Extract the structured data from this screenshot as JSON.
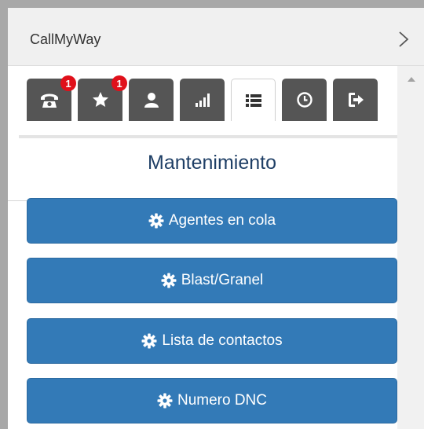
{
  "app": {
    "title": "CallMyWay"
  },
  "tabs": [
    {
      "icon": "phone-icon",
      "badge": "1",
      "active": false
    },
    {
      "icon": "star-icon",
      "badge": "1",
      "active": false
    },
    {
      "icon": "user-icon",
      "badge": "",
      "active": false
    },
    {
      "icon": "signal-bars-icon",
      "badge": "",
      "active": false
    },
    {
      "icon": "list-icon",
      "badge": "",
      "active": true
    },
    {
      "icon": "clock-icon",
      "badge": "",
      "active": false
    },
    {
      "icon": "logout-icon",
      "badge": "",
      "active": false
    }
  ],
  "section": {
    "title": "Mantenimiento"
  },
  "buttons": [
    {
      "label": "Agentes en cola",
      "icon": "gear-icon"
    },
    {
      "label": "Blast/Granel",
      "icon": "gear-icon"
    },
    {
      "label": "Lista de contactos",
      "icon": "gear-icon"
    },
    {
      "label": "Numero DNC",
      "icon": "gear-icon"
    }
  ],
  "colors": {
    "button_bg": "#337ab7",
    "tab_bg": "#555555",
    "badge_bg": "#e0101a",
    "title_text": "#1f3f66"
  }
}
